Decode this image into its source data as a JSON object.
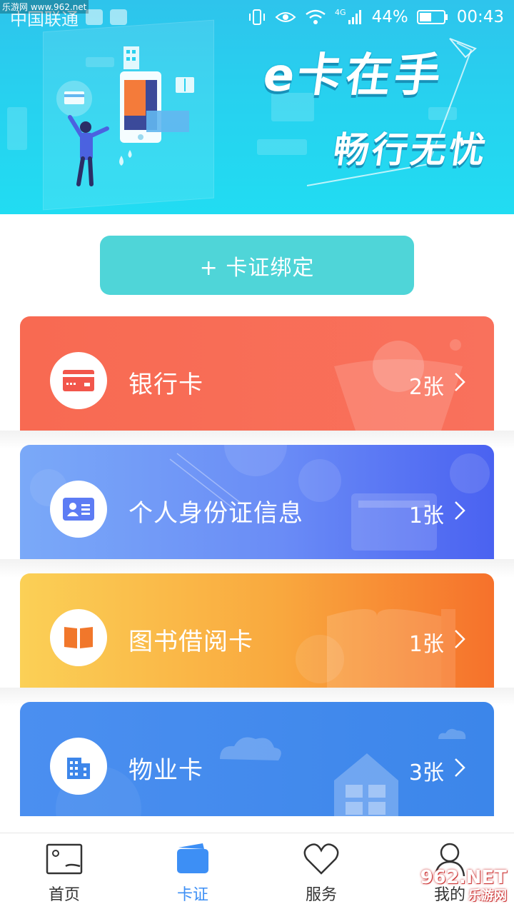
{
  "watermark_top": "乐游网 www.962.net",
  "status_bar": {
    "carrier": "中国联通",
    "network": "4G",
    "battery": "44%",
    "time": "00:43"
  },
  "banner": {
    "slogan_1": "e卡在手",
    "slogan_2": "畅行无忧"
  },
  "bind_button": "+ 卡证绑定",
  "cards": [
    {
      "label": "银行卡",
      "count": "2张",
      "icon": "bank-card-icon"
    },
    {
      "label": "个人身份证信息",
      "count": "1张",
      "icon": "id-card-icon"
    },
    {
      "label": "图书借阅卡",
      "count": "1张",
      "icon": "book-icon"
    },
    {
      "label": "物业卡",
      "count": "3张",
      "icon": "building-icon"
    }
  ],
  "bottom_nav": [
    {
      "label": "首页",
      "icon": "home-icon",
      "active": false
    },
    {
      "label": "卡证",
      "icon": "wallet-icon",
      "active": true
    },
    {
      "label": "服务",
      "icon": "heart-icon",
      "active": false
    },
    {
      "label": "我的",
      "icon": "user-icon",
      "active": false
    }
  ],
  "watermark_bottom": "962.NET",
  "watermark_bottom_sub": "乐游网",
  "colors": {
    "banner": "#27d1ef",
    "bind_button": "#4fd5d8",
    "bank_card": "#f86a52",
    "id_card": "#5d7cf4",
    "library_card": "#f9a83e",
    "property_card": "#4b8ff0",
    "nav_active": "#3d8ff5"
  }
}
